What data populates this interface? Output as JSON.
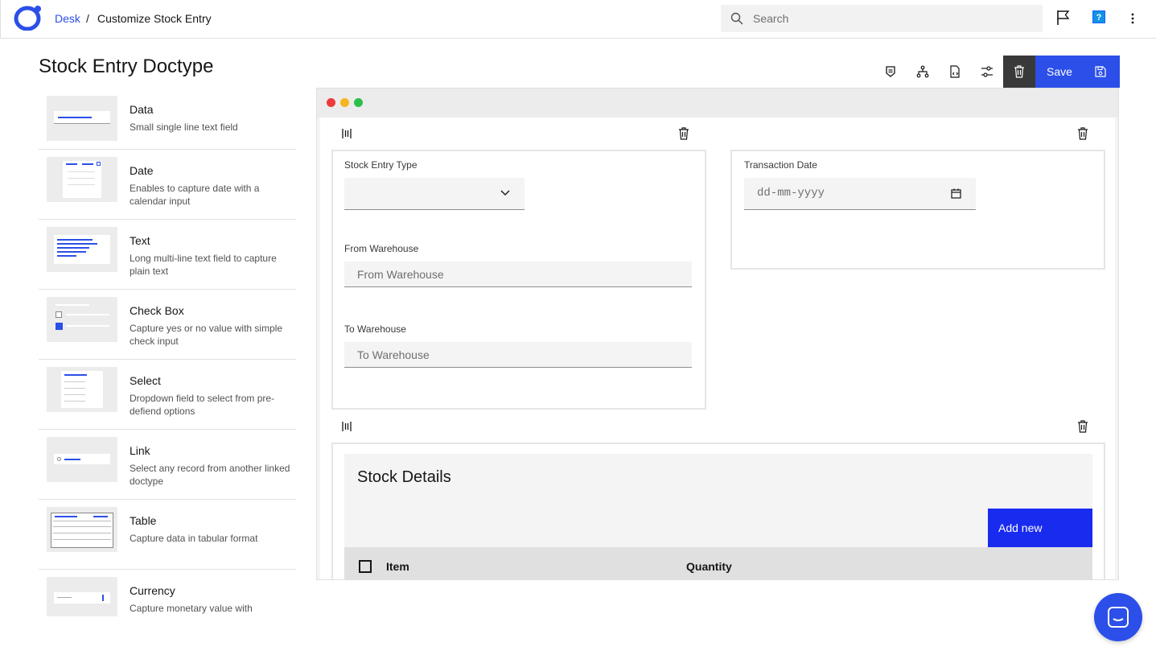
{
  "header": {
    "breadcrumb_root": "Desk",
    "breadcrumb_sep": "/",
    "breadcrumb_current": "Customize Stock Entry",
    "search_placeholder": "Search",
    "help_label": "?"
  },
  "page": {
    "title": "Stock Entry Doctype"
  },
  "palette": {
    "items": [
      {
        "title": "Data",
        "desc": "Small single line text field"
      },
      {
        "title": "Date",
        "desc": "Enables to capture date with a calendar input"
      },
      {
        "title": "Text",
        "desc": "Long multi-line text field to capture plain text"
      },
      {
        "title": "Check Box",
        "desc": "Capture yes or no value with simple check input"
      },
      {
        "title": "Select",
        "desc": "Dropdown field to select from pre-defiend options"
      },
      {
        "title": "Link",
        "desc": "Select any record from another linked doctype"
      },
      {
        "title": "Table",
        "desc": "Capture data in tabular format"
      },
      {
        "title": "Currency",
        "desc": "Capture monetary value with"
      }
    ]
  },
  "toolbar": {
    "save_label": "Save"
  },
  "form": {
    "stock_entry_type_label": "Stock Entry Type",
    "from_warehouse_label": "From Warehouse",
    "from_warehouse_placeholder": "From Warehouse",
    "to_warehouse_label": "To Warehouse",
    "to_warehouse_placeholder": "To Warehouse",
    "transaction_date_label": "Transaction Date",
    "transaction_date_placeholder": "dd-mm-yyyy"
  },
  "table": {
    "title": "Stock Details",
    "add_new_label": "Add new",
    "columns": [
      "Item",
      "Quantity"
    ]
  },
  "colors": {
    "accent": "#2b4fe8",
    "dark": "#393939"
  }
}
